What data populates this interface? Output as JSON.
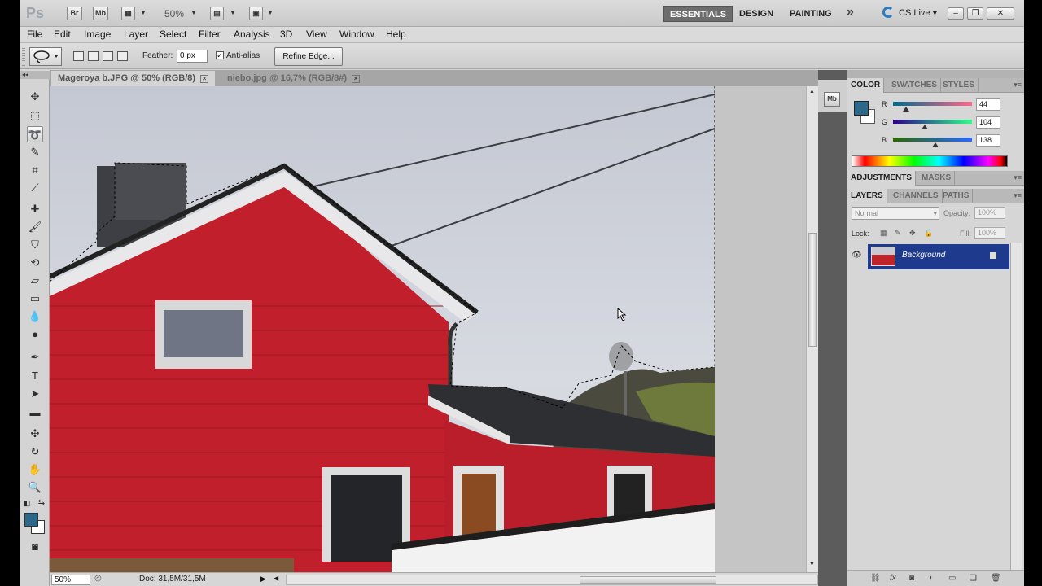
{
  "app": {
    "logo": "Ps",
    "launch_bridge": "Br",
    "launch_mini_bridge": "Mb",
    "zoom_level": "50%",
    "workspaces": [
      "ESSENTIALS",
      "DESIGN",
      "PAINTING"
    ],
    "active_workspace": "ESSENTIALS",
    "more_workspaces": "»",
    "cs_live": "CS Live"
  },
  "menu": [
    "File",
    "Edit",
    "Image",
    "Layer",
    "Select",
    "Filter",
    "Analysis",
    "3D",
    "View",
    "Window",
    "Help"
  ],
  "options": {
    "feather_label": "Feather:",
    "feather_value": "0 px",
    "antialias_label": "Anti-alias",
    "antialias_checked": "✓",
    "refine_edge": "Refine Edge..."
  },
  "tabs": [
    {
      "label": "Mageroya b.JPG @ 50% (RGB/8)",
      "close": "×",
      "active": true
    },
    {
      "label": "niebo.jpg @ 16,7% (RGB/8#)",
      "close": "×",
      "active": false
    }
  ],
  "status": {
    "zoom": "50%",
    "doc": "Doc: 31,5M/31,5M"
  },
  "panels": {
    "color_tabs": [
      "COLOR",
      "SWATCHES",
      "STYLES"
    ],
    "color": {
      "r_label": "R",
      "g_label": "G",
      "b_label": "B",
      "r": "44",
      "g": "104",
      "b": "138",
      "fg_hex": "#2c688a"
    },
    "adjust_tabs": [
      "ADJUSTMENTS",
      "MASKS"
    ],
    "layer_tabs": [
      "LAYERS",
      "CHANNELS",
      "PATHS"
    ],
    "blend_mode": "Normal",
    "opacity_label": "Opacity:",
    "opacity": "100%",
    "lock_label": "Lock:",
    "fill_label": "Fill:",
    "fill": "100%",
    "layers": [
      {
        "name": "Background"
      }
    ]
  }
}
